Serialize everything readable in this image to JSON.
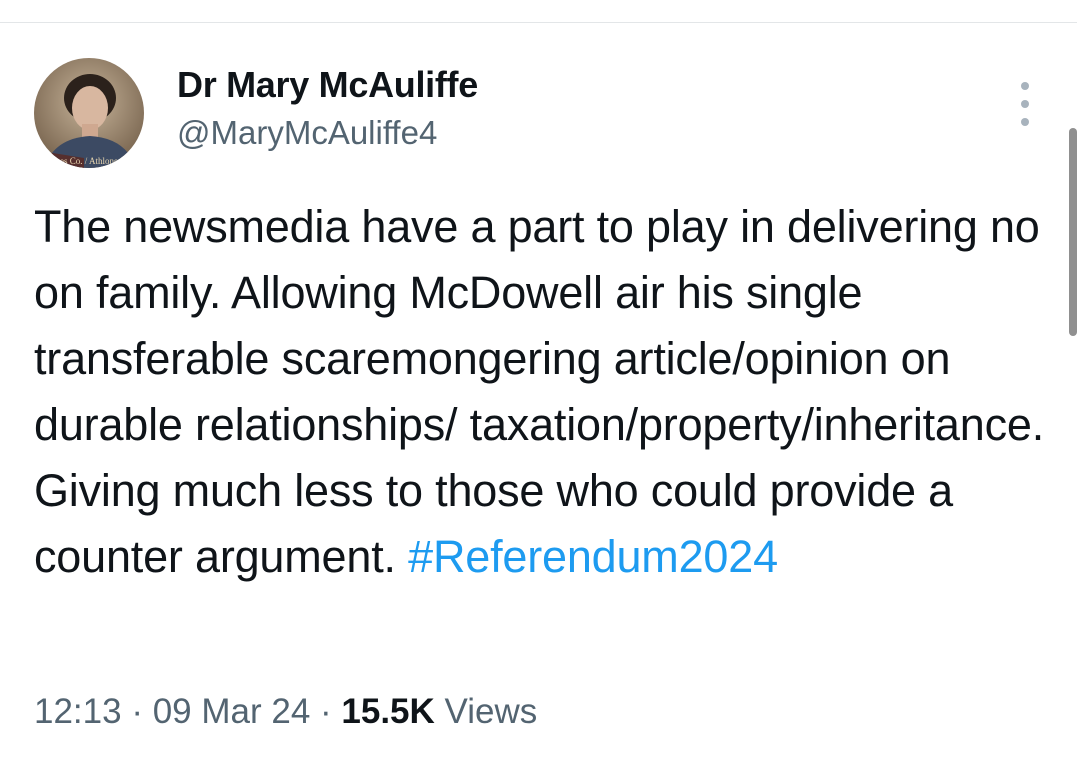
{
  "tweet": {
    "author": {
      "display_name": "Dr Mary McAuliffe",
      "handle": "@MaryMcAuliffe4",
      "avatar_caption": "Dunnes Co. / Athlone"
    },
    "text_before_hashtag": "The newsmedia have a part to play in delivering no on family. Allowing McDowell air his single transferable scaremongering article/opinion on durable relationships/ taxation/property/inheritance. Giving much less to those who could provide a counter argument. ",
    "hashtag": "#Referendum2024",
    "time": "12:13",
    "separator": " · ",
    "date": "09 Mar 24",
    "views_count": "15.5K",
    "views_label": " Views"
  },
  "icons": {
    "more": "more-vertical-icon"
  },
  "colors": {
    "text": "#0f1419",
    "secondary": "#536471",
    "link": "#1d9bf0",
    "divider": "#e3e6e8",
    "more_dots": "#a8b3bd",
    "scrollbar": "#909090"
  }
}
